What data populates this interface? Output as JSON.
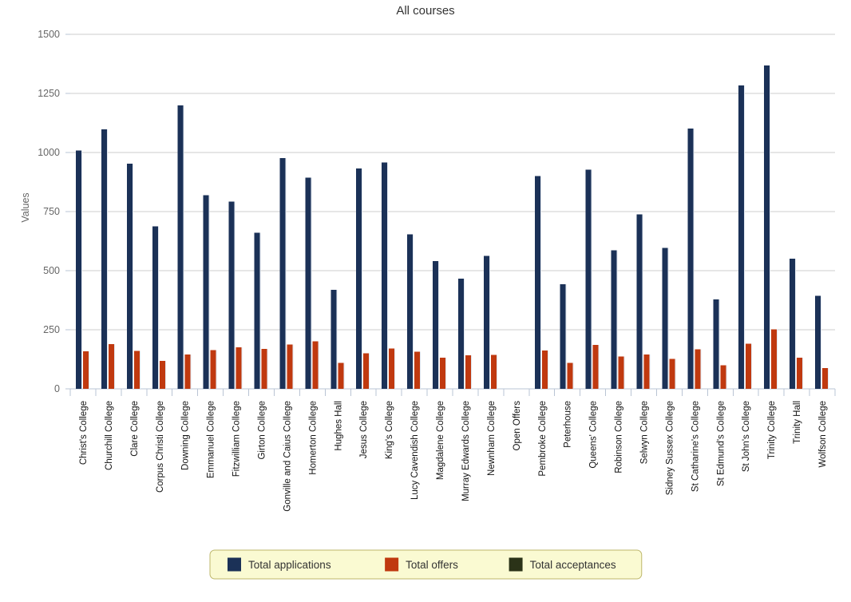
{
  "chart_data": {
    "type": "bar",
    "title": "All courses",
    "xlabel": "",
    "ylabel": "Values",
    "ylim": [
      0,
      1500
    ],
    "yticks": [
      0,
      250,
      500,
      750,
      1000,
      1250,
      1500
    ],
    "grid": true,
    "legend_position": "bottom",
    "categories": [
      "Christ's College",
      "Churchill College",
      "Clare College",
      "Corpus Christi College",
      "Downing College",
      "Emmanuel College",
      "Fitzwilliam College",
      "Girton College",
      "Gonville and Caius College",
      "Homerton College",
      "Hughes Hall",
      "Jesus College",
      "King's College",
      "Lucy Cavendish College",
      "Magdalene College",
      "Murray Edwards College",
      "Newnham College",
      "Open Offers",
      "Pembroke College",
      "Peterhouse",
      "Queens' College",
      "Robinson College",
      "Selwyn College",
      "Sidney Sussex College",
      "St Catharine's College",
      "St Edmund's College",
      "St John's College",
      "Trinity College",
      "Trinity Hall",
      "Wolfson College"
    ],
    "series": [
      {
        "name": "Total applications",
        "color": "#1B3157",
        "values": [
          1008,
          1098,
          952,
          687,
          1200,
          820,
          793,
          660,
          977,
          893,
          419,
          932,
          958,
          654,
          541,
          466,
          563,
          0,
          901,
          443,
          928,
          586,
          738,
          597,
          1101,
          378,
          1283,
          1368,
          551,
          393
        ]
      },
      {
        "name": "Total offers",
        "color": "#C0390F",
        "values": [
          159,
          190,
          160,
          119,
          146,
          164,
          175,
          169,
          187,
          201,
          109,
          150,
          170,
          157,
          132,
          142,
          144,
          0,
          163,
          110,
          186,
          136,
          146,
          127,
          167,
          100,
          191,
          251,
          131,
          87
        ]
      },
      {
        "name": "Total acceptances",
        "color": "#2B3318",
        "values": [
          0,
          0,
          0,
          0,
          0,
          0,
          0,
          0,
          0,
          0,
          0,
          0,
          0,
          0,
          0,
          0,
          0,
          0,
          0,
          0,
          0,
          0,
          0,
          0,
          0,
          0,
          0,
          0,
          0,
          0
        ]
      }
    ]
  },
  "legend": {
    "items": [
      {
        "label": "Total applications",
        "color": "#1B3157"
      },
      {
        "label": "Total offers",
        "color": "#C0390F"
      },
      {
        "label": "Total acceptances",
        "color": "#2B3318"
      }
    ],
    "background": "#FAFAD2",
    "border": "#BDB76B"
  },
  "colors": {
    "background": "#FFFFFF",
    "grid": "#CCCCCC",
    "axis": "#B9C4D4",
    "text": "#333333",
    "tick_text": "#666666"
  }
}
